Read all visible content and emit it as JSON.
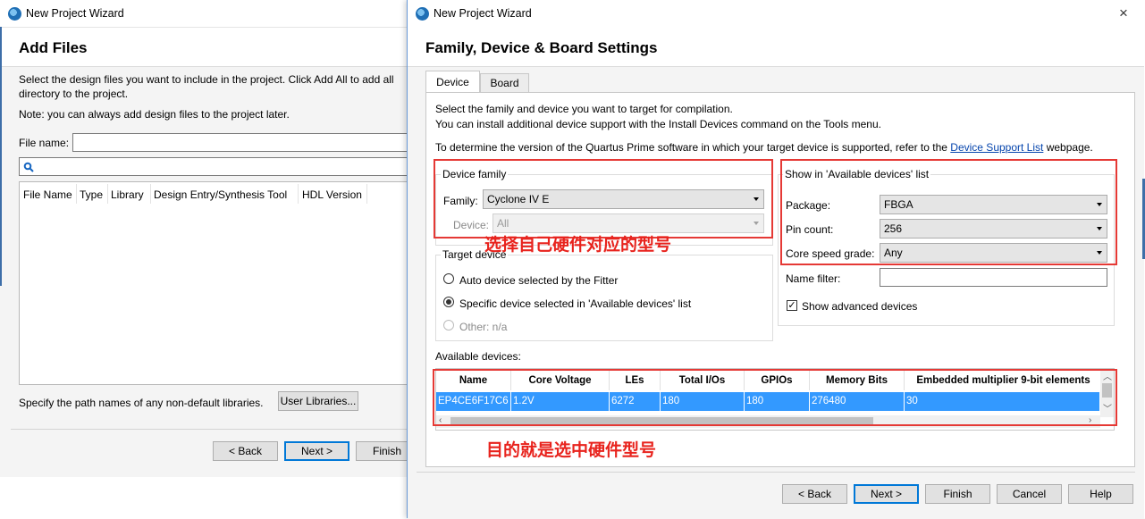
{
  "bg_window": {
    "title": "New Project Wizard",
    "heading": "Add Files",
    "desc_line1": "Select the design files you want to include in the project. Click Add All to add all",
    "desc_line2": "directory to the project.",
    "note": "Note: you can always add design files to the project later.",
    "file_name_label": "File name:",
    "file_name_value": "",
    "columns": [
      "File Name",
      "Type",
      "Library",
      "Design Entry/Synthesis Tool",
      "HDL Version"
    ],
    "libraries_text": "Specify the path names of any non-default libraries.",
    "user_libraries_button": "User Libraries...",
    "back_button": "< Back",
    "next_button": "Next >",
    "finish_button": "Finish"
  },
  "fg_window": {
    "title": "New Project Wizard",
    "close_icon": "×",
    "heading": "Family, Device & Board Settings",
    "tabs": [
      "Device",
      "Board"
    ],
    "intro_line1": "Select the family and device you want to target for compilation.",
    "intro_line2": "You can install additional device support with the Install Devices command on the Tools menu.",
    "support_prefix": "To determine the version of the Quartus Prime software in which your target device is supported, refer to the",
    "support_link": "Device Support List",
    "support_suffix": "webpage.",
    "device_family": {
      "group_label": "Device family",
      "family_label": "Family:",
      "family_value": "Cyclone IV E",
      "device_label": "Device:",
      "device_value": "All"
    },
    "target_device": {
      "group_label": "Target device",
      "options": [
        "Auto device selected by the Fitter",
        "Specific device selected in 'Available devices' list",
        "Other:  n/a"
      ],
      "selected_index": 1
    },
    "show_list": {
      "group_label": "Show in 'Available devices' list",
      "package_label": "Package:",
      "package_value": "FBGA",
      "pin_count_label": "Pin count:",
      "pin_count_value": "256",
      "speed_label": "Core speed grade:",
      "speed_value": "Any",
      "name_filter_label": "Name filter:",
      "name_filter_value": "",
      "show_advanced_label": "Show advanced devices",
      "show_advanced_checked": true
    },
    "available_devices": {
      "label": "Available devices:",
      "columns": [
        "Name",
        "Core Voltage",
        "LEs",
        "Total I/Os",
        "GPIOs",
        "Memory Bits",
        "Embedded multiplier 9-bit elements"
      ],
      "rows": [
        [
          "EP4CE6F17C6",
          "1.2V",
          "6272",
          "180",
          "180",
          "276480",
          "30"
        ]
      ]
    },
    "buttons": {
      "back": "< Back",
      "next": "Next >",
      "finish": "Finish",
      "cancel": "Cancel",
      "help": "Help"
    }
  },
  "annotations": {
    "select_model": "选择自己硬件对应的型号",
    "purpose": "目的就是选中硬件型号"
  },
  "colors": {
    "annotation_red": "#e8231d",
    "selection_blue": "#3399ff",
    "link_blue": "#0645ad"
  }
}
